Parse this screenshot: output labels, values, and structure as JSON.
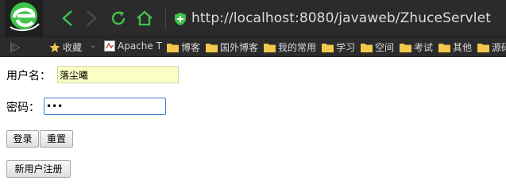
{
  "browser": {
    "url": "http://localhost:8080/javaweb/ZhuceServlet",
    "bookmarks": [
      {
        "label": "收藏",
        "icon": "star-icon"
      },
      {
        "label": "Apache T",
        "icon": "page-icon"
      },
      {
        "label": "博客",
        "icon": "folder-icon"
      },
      {
        "label": "国外博客",
        "icon": "folder-icon"
      },
      {
        "label": "我的常用",
        "icon": "folder-icon"
      },
      {
        "label": "学习",
        "icon": "folder-icon"
      },
      {
        "label": "空间",
        "icon": "folder-icon"
      },
      {
        "label": "考试",
        "icon": "folder-icon"
      },
      {
        "label": "其他",
        "icon": "folder-icon"
      },
      {
        "label": "源码",
        "icon": "folder-icon"
      }
    ],
    "bookmark_toggle": "|▷",
    "colors": {
      "chrome": "#2b2b2b",
      "accent": "#3fc34a",
      "folder": "#f2c94c"
    }
  },
  "form": {
    "username_label": "用户名：",
    "username_value": "落尘曦",
    "password_label": "密码：",
    "password_value": "•••",
    "login_button": "登录",
    "reset_button": "重置",
    "register_button": "新用户注册"
  }
}
